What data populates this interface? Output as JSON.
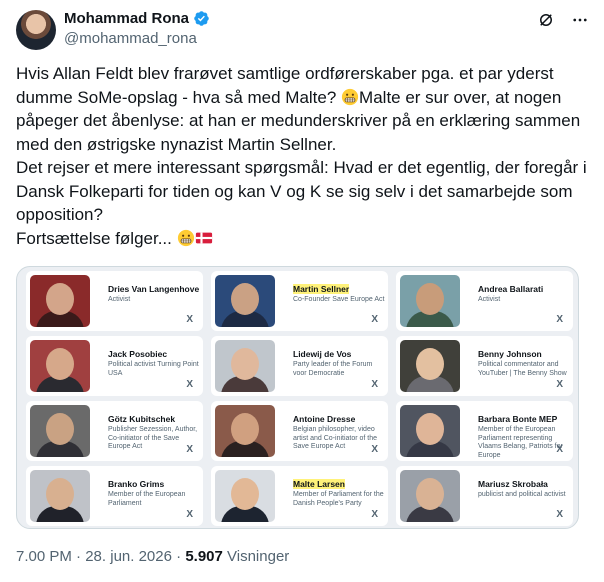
{
  "author": {
    "name": "Mohammad Rona",
    "handle": "@mohammad_rona"
  },
  "tweet": {
    "p1": "Hvis Allan Feldt blev frarøvet samtlige ordførerskaber pga. et par yderst dumme SoMe-opslag - hva så med Malte?",
    "p1b": "Malte er sur over, at nogen påpeger det åbenlyse: at han er medunderskriver på en erklæring sammen med den østrigske nynazist Martin Sellner.",
    "p2": "Det rejser et mere interessant spørgsmål: Hvad er det egentlig, der foregår i Dansk Folkeparti for tiden og kan V og K se sig selv i det samarbejde som opposition?",
    "p3": "Fortsættelse følger..."
  },
  "cards": [
    {
      "name": "Dries Van Langenhove",
      "desc": "Activist",
      "highlight": false
    },
    {
      "name": "Martin Sellner",
      "desc": "Co-Founder Save Europe Act",
      "highlight": true
    },
    {
      "name": "Andrea Ballarati",
      "desc": "Activist",
      "highlight": false
    },
    {
      "name": "Jack Posobiec",
      "desc": "Political activist Turning Point USA",
      "highlight": false
    },
    {
      "name": "Lidewij de Vos",
      "desc": "Party leader of the Forum voor Democratie",
      "highlight": false
    },
    {
      "name": "Benny Johnson",
      "desc": "Political commentator and YouTuber | The Benny Show",
      "highlight": false
    },
    {
      "name": "Götz Kubitschek",
      "desc": "Publisher Sezession, Author, Co-initiator of the Save Europe Act",
      "highlight": false
    },
    {
      "name": "Antoine Dresse",
      "desc": "Belgian philosopher, video artist and Co-initiator of the Save Europe Act",
      "highlight": false
    },
    {
      "name": "Barbara Bonte MEP",
      "desc": "Member of the European Parliament representing Vlaams Belang, Patriots for Europe",
      "highlight": false
    },
    {
      "name": "Branko Grims",
      "desc": "Member of the European Parliament",
      "highlight": false
    },
    {
      "name": "Malte Larsen",
      "desc": "Member of Parliament for the Danish People's Party",
      "highlight": true
    },
    {
      "name": "Mariusz Skrobała",
      "desc": "publicist and political activist",
      "highlight": false
    }
  ],
  "card_close": "X",
  "footer": {
    "time": "7.00 PM",
    "sep1": " · ",
    "date": "28. jun. 2026",
    "sep2": " · ",
    "views": "5.907",
    "views_label": " Visninger"
  },
  "colors": {
    "verified": "#1d9bf0",
    "text": "#0f1419",
    "muted": "#536471",
    "highlight": "#fff27a"
  },
  "icons": [
    "verified-badge-icon",
    "grok-icon",
    "more-icon",
    "grimace-emoji-icon",
    "denmark-flag-icon",
    "close-icon"
  ]
}
